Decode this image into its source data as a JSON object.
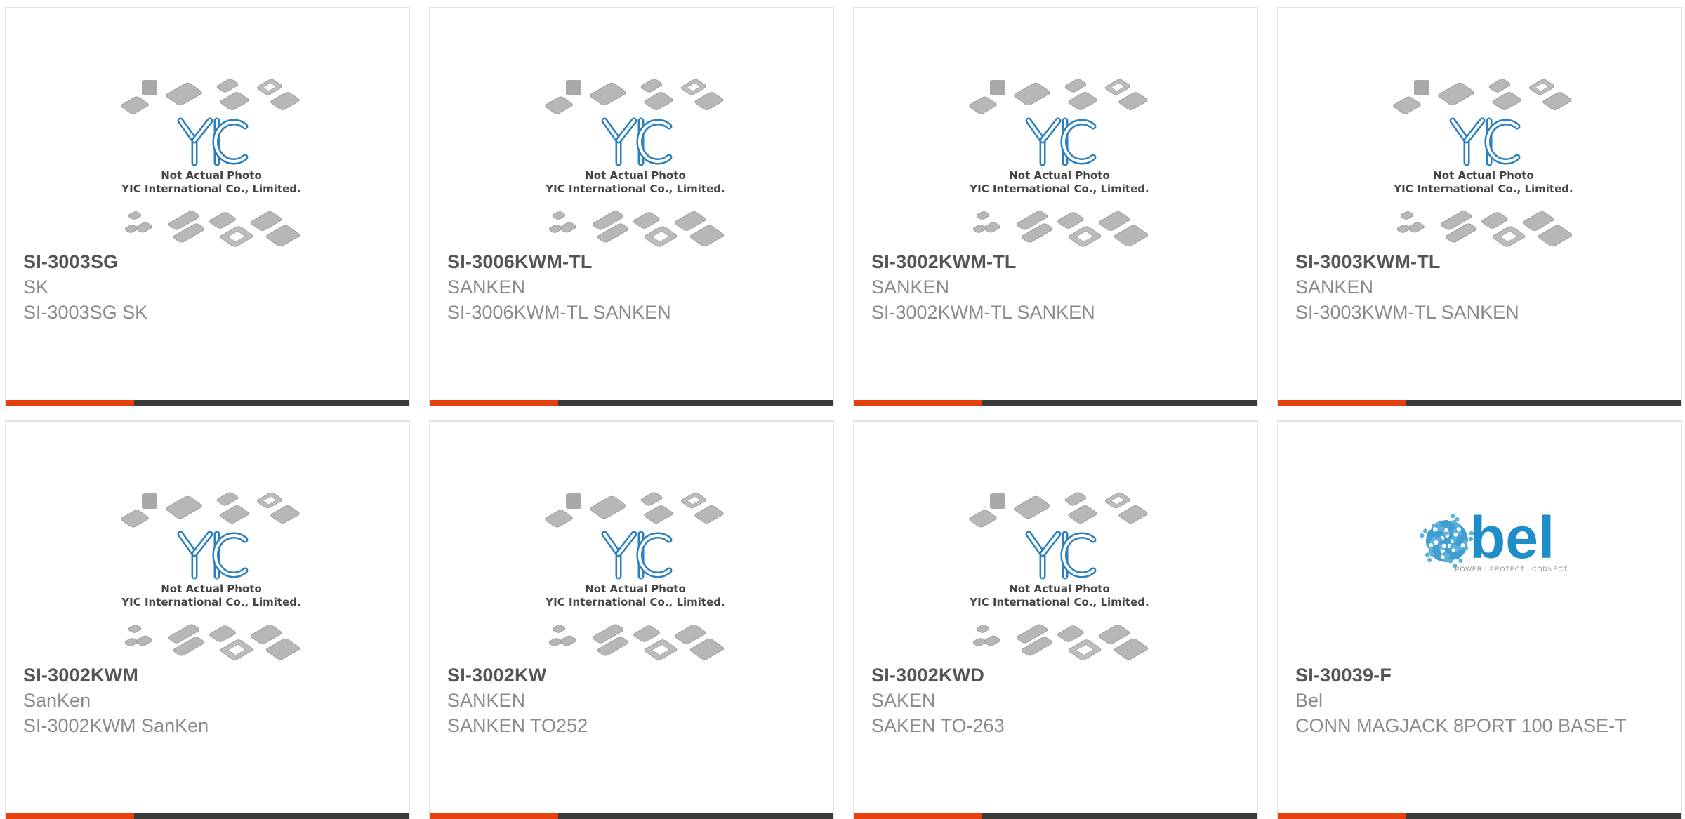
{
  "theme": {
    "accent": "#e6400f",
    "bar_dark": "#3b3b3b",
    "yic_blue": "#2a7fc0",
    "bel_blue": "#1f8ec8"
  },
  "placeholder_image": {
    "brand": "YIC",
    "line1": "Not Actual Photo",
    "line2": "YIC International Co., Limited."
  },
  "bel_logo": {
    "brand": "bel",
    "tagline": "POWER | PROTECT | CONNECT"
  },
  "products": [
    {
      "part_number": "SI-3003SG",
      "manufacturer": "SK",
      "description": "SI-3003SG SK",
      "image": "yic-placeholder"
    },
    {
      "part_number": "SI-3006KWM-TL",
      "manufacturer": "SANKEN",
      "description": "SI-3006KWM-TL SANKEN",
      "image": "yic-placeholder"
    },
    {
      "part_number": "SI-3002KWM-TL",
      "manufacturer": "SANKEN",
      "description": "SI-3002KWM-TL SANKEN",
      "image": "yic-placeholder"
    },
    {
      "part_number": "SI-3003KWM-TL",
      "manufacturer": "SANKEN",
      "description": "SI-3003KWM-TL SANKEN",
      "image": "yic-placeholder"
    },
    {
      "part_number": "SI-3002KWM",
      "manufacturer": "SanKen",
      "description": "SI-3002KWM SanKen",
      "image": "yic-placeholder"
    },
    {
      "part_number": "SI-3002KW",
      "manufacturer": "SANKEN",
      "description": "SANKEN TO252",
      "image": "yic-placeholder"
    },
    {
      "part_number": "SI-3002KWD",
      "manufacturer": "SAKEN",
      "description": "SAKEN TO-263",
      "image": "yic-placeholder"
    },
    {
      "part_number": "SI-30039-F",
      "manufacturer": "Bel",
      "description": "CONN MAGJACK 8PORT 100 BASE-T",
      "image": "bel-logo"
    }
  ]
}
